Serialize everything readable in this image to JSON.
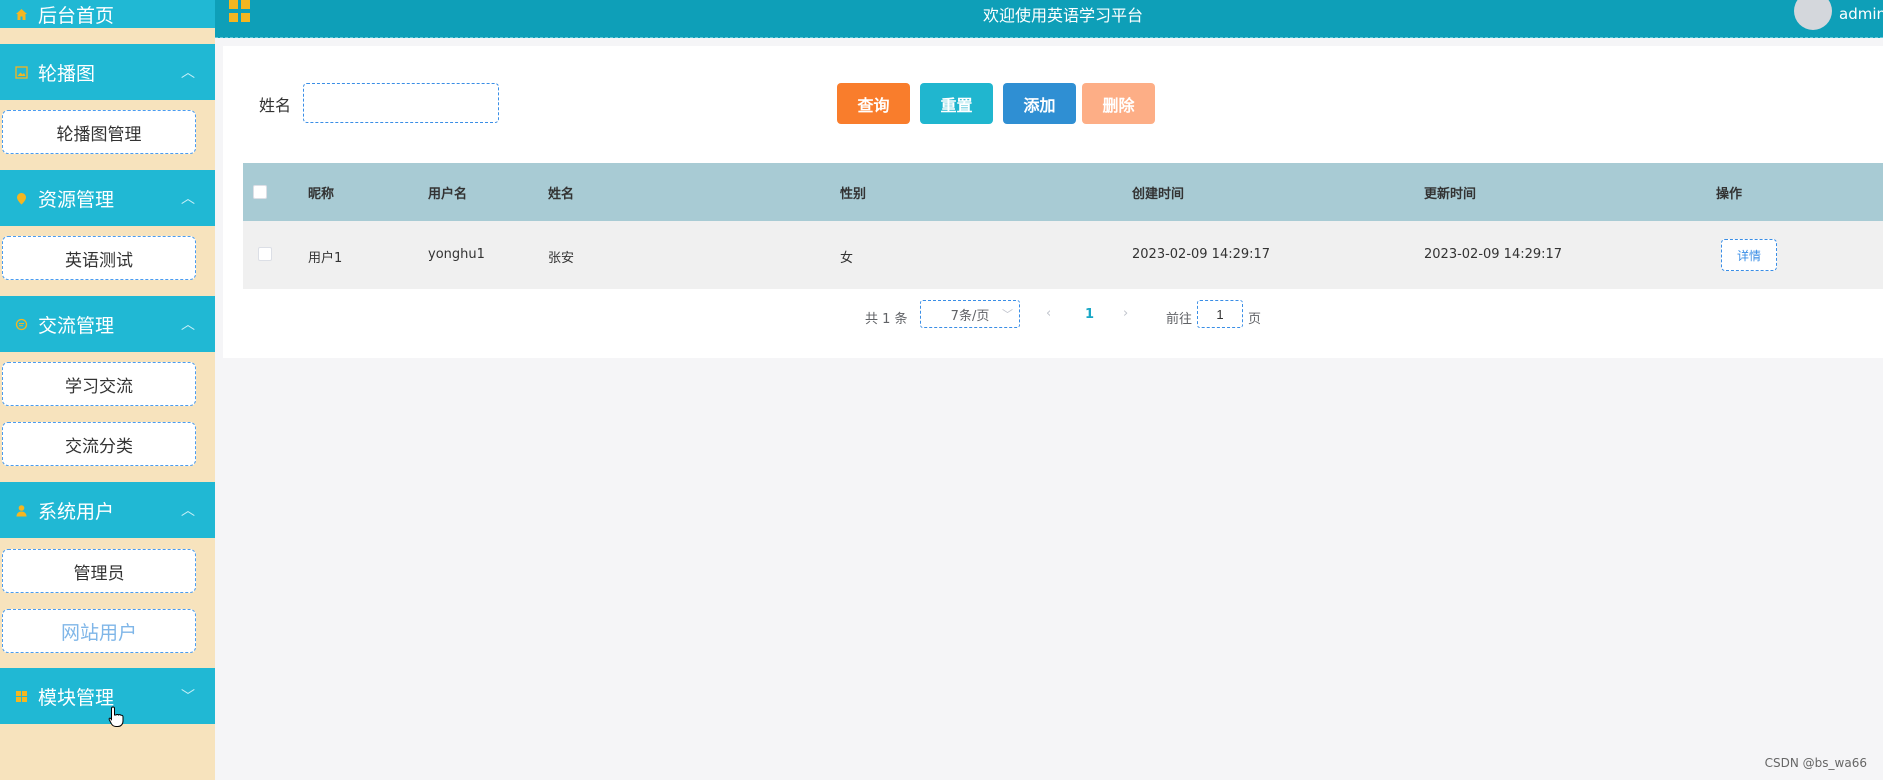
{
  "sidebar": {
    "home": "后台首页",
    "groups": [
      {
        "title": "轮播图",
        "icon": "image-icon",
        "items": [
          "轮播图管理"
        ]
      },
      {
        "title": "资源管理",
        "icon": "location-pin-icon",
        "items": [
          "英语测试"
        ]
      },
      {
        "title": "交流管理",
        "icon": "chat-icon",
        "items": [
          "学习交流",
          "交流分类"
        ]
      },
      {
        "title": "系统用户",
        "icon": "user-icon",
        "items": [
          "管理员",
          "网站用户"
        ]
      },
      {
        "title": "模块管理",
        "icon": "grid-icon",
        "items": []
      }
    ]
  },
  "header": {
    "title": "欢迎使用英语学习平台",
    "username": "admin"
  },
  "search": {
    "label": "姓名",
    "value": "",
    "placeholder": ""
  },
  "toolbar": {
    "query": "查询",
    "reset": "重置",
    "add": "添加",
    "delete": "删除"
  },
  "table": {
    "columns": [
      "昵称",
      "用户名",
      "姓名",
      "性别",
      "创建时间",
      "更新时间",
      "操作"
    ],
    "rows": [
      {
        "nickname": "用户1",
        "username": "yonghu1",
        "name": "张安",
        "gender": "女",
        "created": "2023-02-09 14:29:17",
        "updated": "2023-02-09 14:29:17",
        "action": "详情"
      }
    ]
  },
  "pagination": {
    "total": "共 1 条",
    "page_size": "7条/页",
    "current_page": "1",
    "goto_label": "前往",
    "goto_value": "1",
    "page_suffix": "页"
  },
  "watermark": "CSDN @bs_wa66",
  "colors": {
    "sidebar_bg": "#f7e3bd",
    "menu_head": "#20b8d4",
    "header": "#0e9fb8",
    "query": "#f97d2c",
    "reset": "#20b6cf",
    "add": "#2f8fd3",
    "delete": "#fdae86",
    "table_head": "#a8cbd4"
  }
}
